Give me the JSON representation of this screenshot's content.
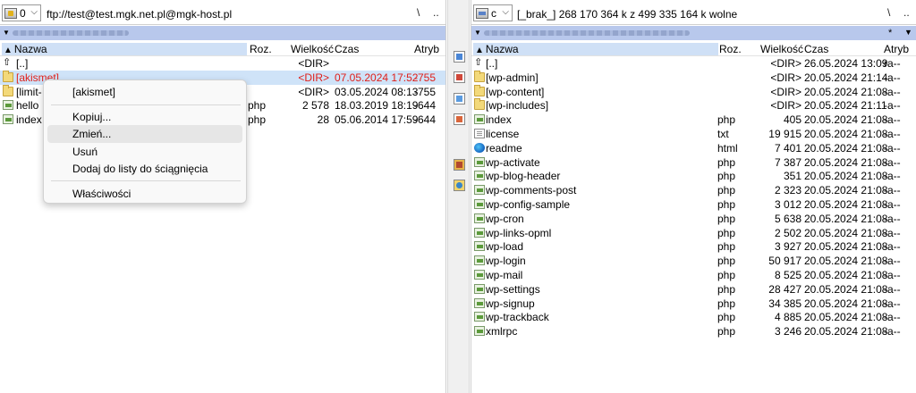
{
  "left": {
    "drive": "0",
    "path": "ftp://test@test.mgk.net.pl@mgk-host.pl",
    "root_btn": "\\",
    "up_btn": "..",
    "columns": {
      "name": "Nazwa",
      "ext": "Roz.",
      "size": "Wielkość",
      "date": "Czas",
      "attr": "Atryb"
    },
    "rows": [
      {
        "icon": "up-icon",
        "name": "[..]",
        "ext": "",
        "size": "<DIR>",
        "date": "",
        "attr": "",
        "selected": false
      },
      {
        "icon": "folder-icon",
        "name": "[akismet]",
        "ext": "",
        "size": "<DIR>",
        "date": "07.05.2024 17:52",
        "attr": "-755",
        "selected": true
      },
      {
        "icon": "folder-icon",
        "name": "[limit-",
        "ext": "",
        "size": "<DIR>",
        "date": "03.05.2024 08:13",
        "attr": "-755",
        "selected": false
      },
      {
        "icon": "script-icon",
        "name": "hello",
        "ext": "php",
        "size": "2 578",
        "date": "18.03.2019 18:19",
        "attr": "-644",
        "selected": false
      },
      {
        "icon": "script-icon",
        "name": "index",
        "ext": "php",
        "size": "28",
        "date": "05.06.2014 17:59",
        "attr": "-644",
        "selected": false
      }
    ]
  },
  "right": {
    "drive": "c",
    "path": "[_brak_]  268 170 364 k z 499 335 164 k wolne",
    "root_btn": "\\",
    "up_btn": "..",
    "star": "*",
    "columns": {
      "name": "Nazwa",
      "ext": "Roz.",
      "size": "Wielkość",
      "date": "Czas",
      "attr": "Atryb"
    },
    "rows": [
      {
        "icon": "up-icon",
        "name": "[..]",
        "ext": "",
        "size": "<DIR>",
        "date": "26.05.2024 13:09",
        "attr": "ra--"
      },
      {
        "icon": "folder-icon",
        "name": "[wp-admin]",
        "ext": "",
        "size": "<DIR>",
        "date": "20.05.2024 21:14",
        "attr": "-a--"
      },
      {
        "icon": "folder-icon",
        "name": "[wp-content]",
        "ext": "",
        "size": "<DIR>",
        "date": "20.05.2024 21:08",
        "attr": "-a--"
      },
      {
        "icon": "folder-icon",
        "name": "[wp-includes]",
        "ext": "",
        "size": "<DIR>",
        "date": "20.05.2024 21:11",
        "attr": "-a--"
      },
      {
        "icon": "script-icon",
        "name": "index",
        "ext": "php",
        "size": "405",
        "date": "20.05.2024 21:08",
        "attr": "-a--"
      },
      {
        "icon": "text-file-icon",
        "name": "license",
        "ext": "txt",
        "size": "19 915",
        "date": "20.05.2024 21:08",
        "attr": "-a--"
      },
      {
        "icon": "edge-browser-icon",
        "name": "readme",
        "ext": "html",
        "size": "7 401",
        "date": "20.05.2024 21:08",
        "attr": "-a--"
      },
      {
        "icon": "script-icon",
        "name": "wp-activate",
        "ext": "php",
        "size": "7 387",
        "date": "20.05.2024 21:08",
        "attr": "-a--"
      },
      {
        "icon": "script-icon",
        "name": "wp-blog-header",
        "ext": "php",
        "size": "351",
        "date": "20.05.2024 21:08",
        "attr": "-a--"
      },
      {
        "icon": "script-icon",
        "name": "wp-comments-post",
        "ext": "php",
        "size": "2 323",
        "date": "20.05.2024 21:08",
        "attr": "-a--"
      },
      {
        "icon": "script-icon",
        "name": "wp-config-sample",
        "ext": "php",
        "size": "3 012",
        "date": "20.05.2024 21:08",
        "attr": "-a--"
      },
      {
        "icon": "script-icon",
        "name": "wp-cron",
        "ext": "php",
        "size": "5 638",
        "date": "20.05.2024 21:08",
        "attr": "-a--"
      },
      {
        "icon": "script-icon",
        "name": "wp-links-opml",
        "ext": "php",
        "size": "2 502",
        "date": "20.05.2024 21:08",
        "attr": "-a--"
      },
      {
        "icon": "script-icon",
        "name": "wp-load",
        "ext": "php",
        "size": "3 927",
        "date": "20.05.2024 21:08",
        "attr": "-a--"
      },
      {
        "icon": "script-icon",
        "name": "wp-login",
        "ext": "php",
        "size": "50 917",
        "date": "20.05.2024 21:08",
        "attr": "-a--"
      },
      {
        "icon": "script-icon",
        "name": "wp-mail",
        "ext": "php",
        "size": "8 525",
        "date": "20.05.2024 21:08",
        "attr": "-a--"
      },
      {
        "icon": "script-icon",
        "name": "wp-settings",
        "ext": "php",
        "size": "28 427",
        "date": "20.05.2024 21:08",
        "attr": "-a--"
      },
      {
        "icon": "script-icon",
        "name": "wp-signup",
        "ext": "php",
        "size": "34 385",
        "date": "20.05.2024 21:08",
        "attr": "-a--"
      },
      {
        "icon": "script-icon",
        "name": "wp-trackback",
        "ext": "php",
        "size": "4 885",
        "date": "20.05.2024 21:08",
        "attr": "-a--"
      },
      {
        "icon": "script-icon",
        "name": "xmlrpc",
        "ext": "php",
        "size": "3 246",
        "date": "20.05.2024 21:08",
        "attr": "-a--"
      }
    ]
  },
  "context_menu": {
    "title": "[akismet]",
    "items": [
      "Kopiuj...",
      "Zmień...",
      "Usuń",
      "Dodaj do listy do ściągnięcia",
      "Właściwości"
    ]
  },
  "colors": {
    "selection_text": "#e0201a",
    "header_highlight": "#cfe0f6",
    "path_bar": "#b8c8ec"
  }
}
